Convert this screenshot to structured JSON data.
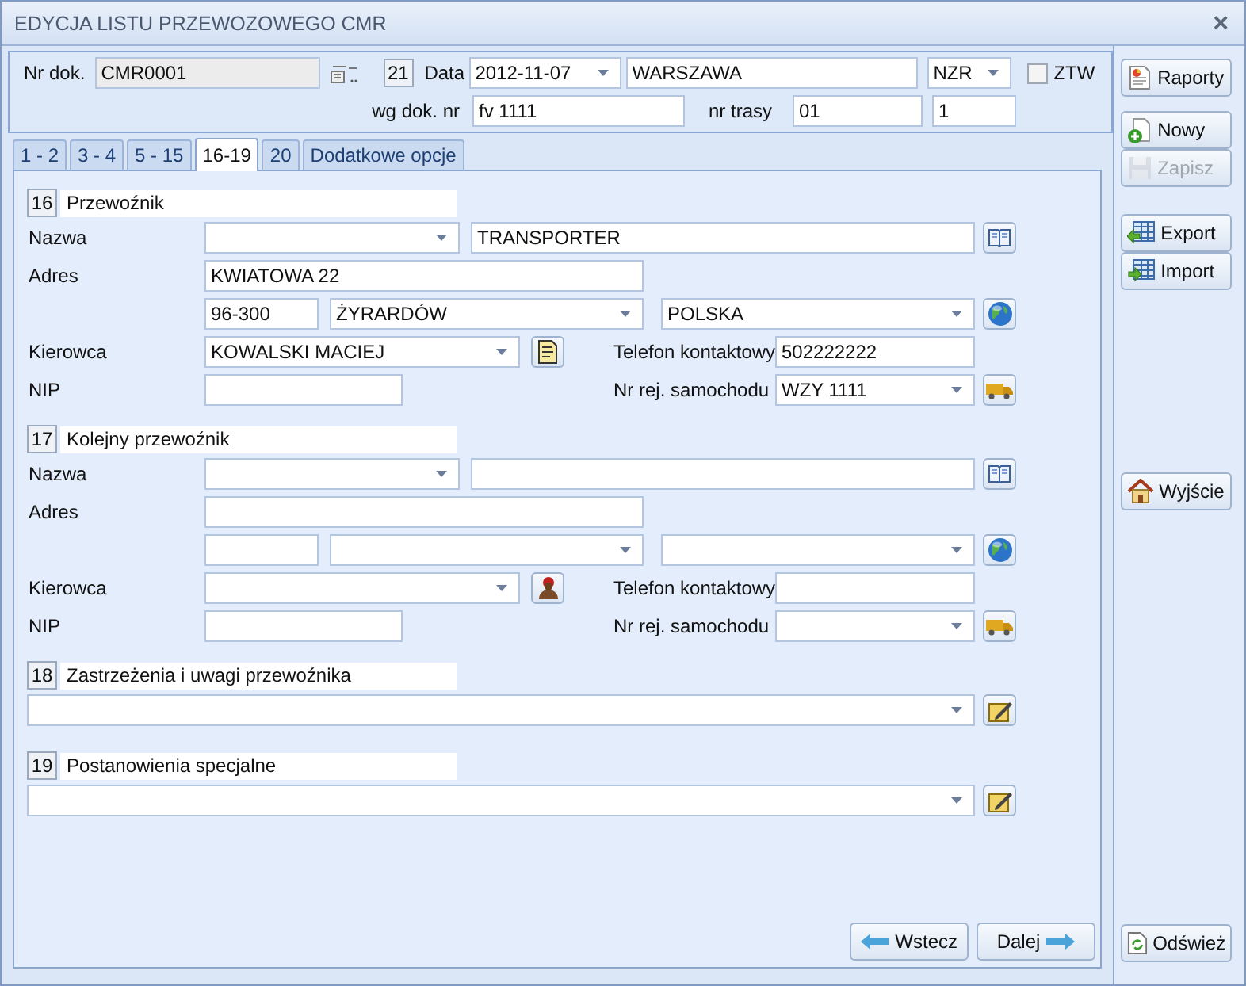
{
  "window": {
    "title": "EDYCJA LISTU PRZEWOZOWEGO CMR",
    "close": "×"
  },
  "header": {
    "doc_label": "Nr dok.",
    "doc_number": "CMR0001",
    "doc_disabled": true,
    "box_number": "21",
    "date_label": "Data",
    "date": "2012-11-07",
    "place": "WARSZAWA",
    "type": "NZR",
    "ztw": {
      "label": "ZTW",
      "checked": false
    },
    "ref_label": "wg dok. nr",
    "ref": "fv 1111",
    "route_label": "nr trasy",
    "route": "01",
    "route_no": "1"
  },
  "tabs": [
    {
      "label": "1 - 2",
      "selected": false
    },
    {
      "label": "3 - 4",
      "selected": false
    },
    {
      "label": "5 - 15",
      "selected": false
    },
    {
      "label": "16-19",
      "selected": true
    },
    {
      "label": "20",
      "selected": false
    },
    {
      "label": "Dodatkowe opcje",
      "selected": false
    }
  ],
  "sections": [
    {
      "kind": "carrier",
      "number": "16",
      "title": "Przewoźnik",
      "name_label": "Nazwa",
      "name": "TRANSPORTER",
      "address_label": "Adres",
      "street": "KWIATOWA 22",
      "postal_code": "96-300",
      "city": "ŻYRARDÓW",
      "country": "POLSKA",
      "driver_label": "Kierowca",
      "driver": "KOWALSKI MACIEJ",
      "phone_label": "Telefon kontaktowy",
      "phone": "502222222",
      "nip_label": "NIP",
      "plate_label": "Nr rej. samochodu",
      "plate": "WZY 1111"
    },
    {
      "kind": "carrier",
      "number": "17",
      "title": "Kolejny przewoźnik",
      "name_label": "Nazwa",
      "address_label": "Adres",
      "driver_label": "Kierowca",
      "phone_label": "Telefon kontaktowy",
      "nip_label": "NIP",
      "plate_label": "Nr rej. samochodu"
    },
    {
      "kind": "note",
      "number": "18",
      "title": "Zastrzeżenia i uwagi przewoźnika"
    },
    {
      "kind": "note",
      "number": "19",
      "title": "Postanowienia specjalne"
    }
  ],
  "navigation": {
    "back": "Wstecz",
    "next": "Dalej"
  },
  "sidebar": [
    {
      "kind": "report",
      "label": "Raporty",
      "disabled": false
    },
    {
      "kind": "new",
      "label": "Nowy",
      "disabled": false
    },
    {
      "kind": "save",
      "label": "Zapisz",
      "disabled": true
    },
    {
      "kind": "export",
      "label": "Export",
      "disabled": false
    },
    {
      "kind": "import",
      "label": "Import",
      "disabled": false
    },
    {
      "kind": "exit",
      "label": "Wyjście",
      "disabled": false
    },
    {
      "kind": "refresh",
      "label": "Odśwież",
      "disabled": false
    }
  ]
}
